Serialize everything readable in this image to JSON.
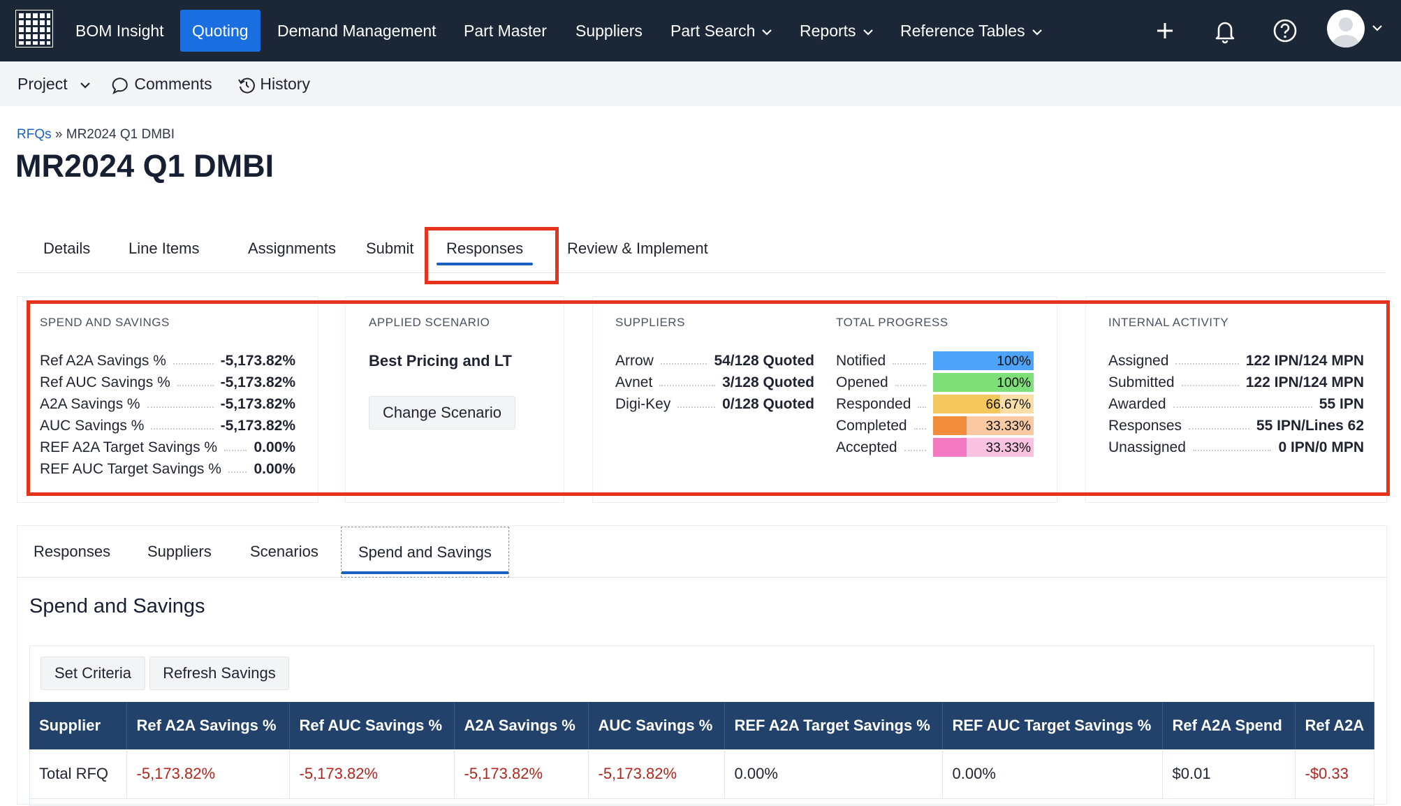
{
  "nav": {
    "brand": "BOM Insight",
    "items": [
      {
        "label": "Quoting",
        "active": true
      },
      {
        "label": "Demand Management"
      },
      {
        "label": "Part Master"
      },
      {
        "label": "Suppliers"
      },
      {
        "label": "Part Search",
        "dropdown": true
      },
      {
        "label": "Reports",
        "dropdown": true
      },
      {
        "label": "Reference Tables",
        "dropdown": true
      }
    ],
    "icons": [
      "plus-icon",
      "bell-icon",
      "help-icon",
      "avatar"
    ]
  },
  "subbar": {
    "project": "Project",
    "comments": "Comments",
    "history": "History"
  },
  "breadcrumb": {
    "root": "RFQs",
    "sep": "»",
    "current": "MR2024 Q1 DMBI"
  },
  "page_title": "MR2024 Q1 DMBI",
  "main_tabs": [
    "Details",
    "Line Items",
    "Assignments",
    "Submit",
    "Responses",
    "Review & Implement"
  ],
  "active_main_tab": "Responses",
  "spend_savings": {
    "heading": "SPEND AND SAVINGS",
    "rows": [
      {
        "label": "Ref A2A Savings %",
        "value": "-5,173.82%"
      },
      {
        "label": "Ref AUC Savings %",
        "value": "-5,173.82%"
      },
      {
        "label": "A2A Savings %",
        "value": "-5,173.82%"
      },
      {
        "label": "AUC Savings %",
        "value": "-5,173.82%"
      },
      {
        "label": "REF A2A Target Savings %",
        "value": "0.00%"
      },
      {
        "label": "REF AUC Target Savings %",
        "value": "0.00%"
      }
    ]
  },
  "applied_scenario": {
    "heading": "APPLIED SCENARIO",
    "name": "Best Pricing and LT",
    "button": "Change Scenario"
  },
  "suppliers": {
    "heading": "SUPPLIERS",
    "rows": [
      {
        "label": "Arrow",
        "value": "54/128 Quoted"
      },
      {
        "label": "Avnet",
        "value": "3/128 Quoted"
      },
      {
        "label": "Digi-Key",
        "value": "0/128 Quoted"
      }
    ]
  },
  "total_progress": {
    "heading": "TOTAL PROGRESS",
    "rows": [
      {
        "label": "Notified",
        "pct": "100%",
        "fraction": 1.0,
        "color": "#4da3f7",
        "track": "#4da3f7"
      },
      {
        "label": "Opened",
        "pct": "100%",
        "fraction": 1.0,
        "color": "#7fe07a",
        "track": "#7fe07a"
      },
      {
        "label": "Responded",
        "pct": "66.67%",
        "fraction": 0.6667,
        "color": "#f5c85e",
        "track": "#f9dfa5"
      },
      {
        "label": "Completed",
        "pct": "33.33%",
        "fraction": 0.3333,
        "color": "#f08c3c",
        "track": "#f8c9a2"
      },
      {
        "label": "Accepted",
        "pct": "33.33%",
        "fraction": 0.3333,
        "color": "#f37ac1",
        "track": "#f8c2e0"
      }
    ]
  },
  "internal_activity": {
    "heading": "INTERNAL ACTIVITY",
    "rows": [
      {
        "label": "Assigned",
        "value": "122 IPN/124 MPN"
      },
      {
        "label": "Submitted",
        "value": "122 IPN/124 MPN"
      },
      {
        "label": "Awarded",
        "value": "55 IPN"
      },
      {
        "label": "Responses",
        "value": "55 IPN/Lines 62"
      },
      {
        "label": "Unassigned",
        "value": "0 IPN/0 MPN"
      }
    ]
  },
  "sub_tabs": [
    "Responses",
    "Suppliers",
    "Scenarios",
    "Spend and Savings"
  ],
  "active_sub_tab": "Spend and Savings",
  "section_title": "Spend and Savings",
  "toolbar": {
    "set_criteria": "Set Criteria",
    "refresh": "Refresh Savings"
  },
  "table": {
    "columns": [
      "Supplier",
      "Ref A2A Savings %",
      "Ref AUC Savings %",
      "A2A Savings %",
      "AUC Savings %",
      "REF A2A Target Savings %",
      "REF AUC Target Savings %",
      "Ref A2A Spend",
      "Ref A2A"
    ],
    "rows": [
      [
        "Total RFQ",
        "-5,173.82%",
        "-5,173.82%",
        "-5,173.82%",
        "-5,173.82%",
        "0.00%",
        "0.00%",
        "$0.01",
        "-$0.33"
      ]
    ]
  },
  "colors": {
    "nav_bg": "#1b2637",
    "accent": "#1a6fe0",
    "table_header": "#22426c",
    "negative": "#b3261e",
    "highlight": "#e8331c"
  }
}
